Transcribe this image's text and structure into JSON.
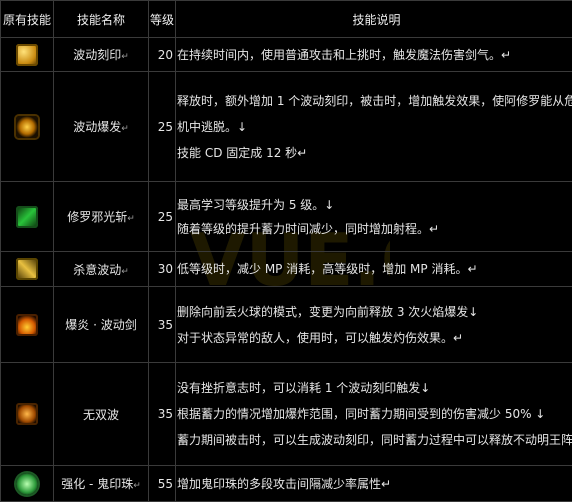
{
  "headers": {
    "original_skill": "原有技能",
    "skill_name": "技能名称",
    "level": "等级",
    "description": "技能说明"
  },
  "rows": [
    {
      "icon": "wave-seal-icon",
      "name": "波动刻印",
      "level": "20",
      "desc": [
        "在持续时间内，使用普通攻击和上挑时，触发魔法伤害剑气。↵"
      ]
    },
    {
      "icon": "wave-burst-icon",
      "name": "波动爆发",
      "level": "25",
      "desc": [
        "释放时，额外增加 1 个波动刻印，被击时，增加触发效果，使阿修罗能从危",
        "机中逃脱。↓",
        "技能 CD 固定成 12 秒↵"
      ]
    },
    {
      "icon": "asura-slash-icon",
      "name": "修罗邪光斩",
      "level": "25",
      "desc": [
        "最高学习等级提升为 5 级。↓",
        "随着等级的提升蓄力时间减少，同时增加射程。↵"
      ]
    },
    {
      "icon": "killing-wave-icon",
      "name": "杀意波动",
      "level": "30",
      "desc": [
        "低等级时，减少 MP 消耗，高等级时，增加 MP 消耗。↵"
      ]
    },
    {
      "icon": "flame-sword-icon",
      "name": "爆炎 · 波动剑",
      "level": "35",
      "desc": [
        "删除向前丢火球的模式，变更为向前释放 3 次火焰爆发↓",
        "对于状态异常的敌人，使用时，可以触发灼伤效果。↵"
      ]
    },
    {
      "icon": "unmatched-wave-icon",
      "name": "无双波",
      "level": "35",
      "desc": [
        "没有挫折意志时，可以消耗 1 个波动刻印触发↓",
        "根据蓄力的情况增加爆炸范围，同时蓄力期间受到的伤害减少 50%  ↓",
        "蓄力期间被击时，可以生成波动刻印，同时蓄力过程中可以释放不动明王阵"
      ]
    },
    {
      "icon": "ghost-bead-icon",
      "name": "强化 - 鬼印珠",
      "level": "55",
      "desc": [
        "增加鬼印珠的多段攻击间隔减少率属性↵"
      ]
    }
  ],
  "watermark": "VUE.COM"
}
